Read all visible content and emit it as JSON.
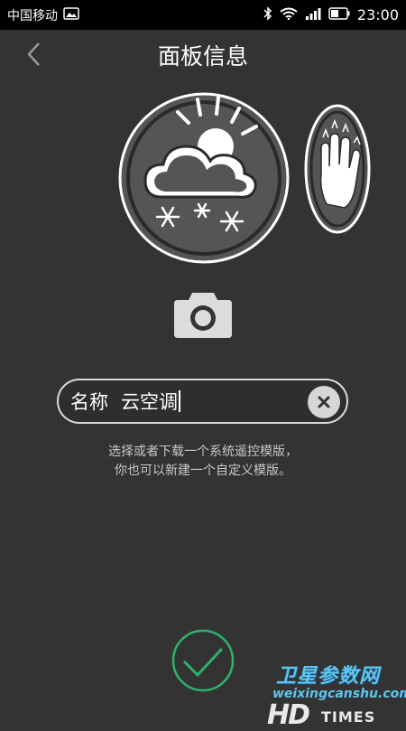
{
  "status_bar": {
    "carrier": "中国移动",
    "time": "23:00",
    "icons": [
      "image-icon",
      "bluetooth-icon",
      "wifi-icon",
      "signal-icon",
      "battery-icon"
    ]
  },
  "header": {
    "title": "面板信息",
    "back_icon": "chevron-left-icon"
  },
  "panel": {
    "weather_icon": "cloud-sun-snow-icon",
    "gesture_icon": "hand-gesture-icon",
    "camera_icon": "camera-icon"
  },
  "name_field": {
    "label": "名称",
    "value": "云空调",
    "clear_icon": "clear-icon"
  },
  "hint": {
    "line1": "选择或者下载一个系统遥控模版，",
    "line2": "你也可以新建一个自定义模版。"
  },
  "confirm": {
    "icon": "checkmark-icon",
    "color": "#2db36b"
  },
  "watermark": {
    "cn": "卫星参数网",
    "en": "weixingcanshu.com",
    "hd": "HD",
    "times": "TIMES"
  }
}
